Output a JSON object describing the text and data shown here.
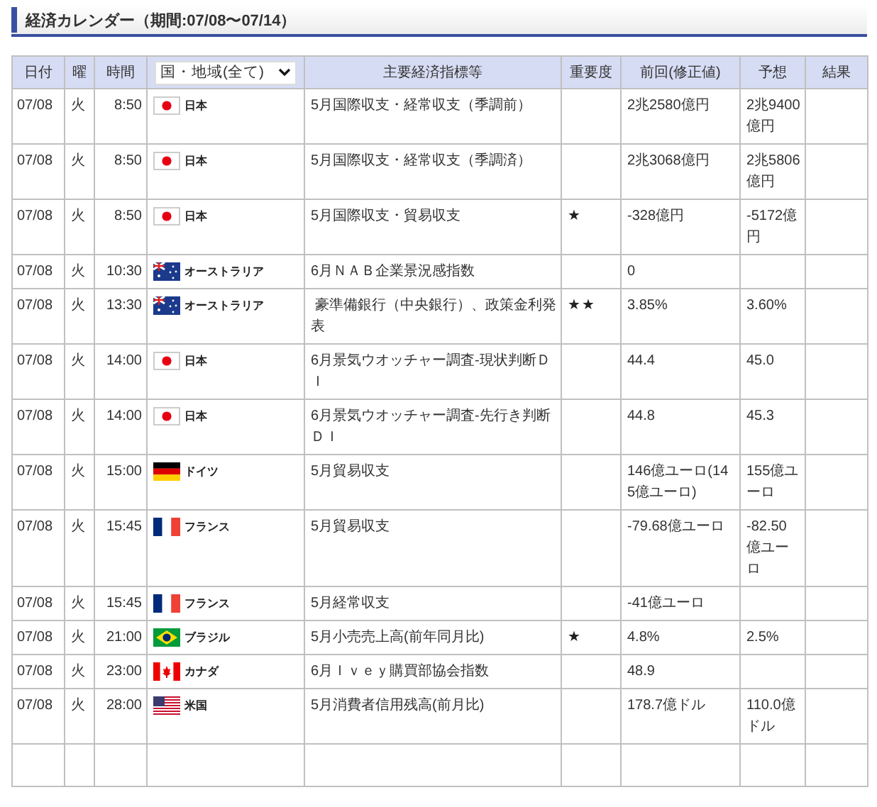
{
  "title": "経済カレンダー（期間:07/08〜07/14）",
  "table": {
    "columns": [
      "日付",
      "曜",
      "時間",
      "主要経済指標等",
      "重要度",
      "前回(修正値)",
      "予想",
      "結果"
    ],
    "country_filter": {
      "value": "国・地域(全て)"
    },
    "rows": [
      {
        "date": "07/08",
        "weekday": "火",
        "time": "8:50",
        "kind": "jp",
        "country": "日本",
        "indicator": "5月国際収支・経常収支（季調前）",
        "previous": "2兆2580億円",
        "forecast": "2兆9400億円"
      },
      {
        "date": "07/08",
        "weekday": "火",
        "time": "8:50",
        "kind": "jp",
        "country": "日本",
        "indicator": "5月国際収支・経常収支（季調済）",
        "previous": "2兆3068億円",
        "forecast": "2兆5806億円"
      },
      {
        "date": "07/08",
        "weekday": "火",
        "time": "8:50",
        "kind": "jp",
        "country": "日本",
        "indicator": "5月国際収支・貿易収支",
        "importance": "★",
        "previous": "-328億円",
        "forecast": "-5172億円"
      },
      {
        "date": "07/08",
        "weekday": "火",
        "time": "10:30",
        "kind": "au",
        "country": "オーストラリア",
        "indicator": "6月ＮＡＢ企業景況感指数",
        "previous": "0"
      },
      {
        "date": "07/08",
        "weekday": "火",
        "time": "13:30",
        "kind": "au",
        "country": "オーストラリア",
        "indicator": " 豪準備銀行（中央銀行）、政策金利発表",
        "importance": "★★",
        "previous": "3.85%",
        "forecast": "3.60%"
      },
      {
        "date": "07/08",
        "weekday": "火",
        "time": "14:00",
        "kind": "jp",
        "country": "日本",
        "indicator": "6月景気ウオッチャー調査-現状判断ＤＩ",
        "previous": "44.4",
        "forecast": "45.0"
      },
      {
        "date": "07/08",
        "weekday": "火",
        "time": "14:00",
        "kind": "jp",
        "country": "日本",
        "indicator": "6月景気ウオッチャー調査-先行き判断ＤＩ",
        "previous": "44.8",
        "forecast": "45.3"
      },
      {
        "date": "07/08",
        "weekday": "火",
        "time": "15:00",
        "kind": "de",
        "country": "ドイツ",
        "indicator": "5月貿易収支",
        "previous": "146億ユーロ(145億ユーロ)",
        "forecast": "155億ユーロ"
      },
      {
        "date": "07/08",
        "weekday": "火",
        "time": "15:45",
        "kind": "fr",
        "country": "フランス",
        "indicator": "5月貿易収支",
        "previous": "-79.68億ユーロ",
        "forecast": "-82.50億ユーロ"
      },
      {
        "date": "07/08",
        "weekday": "火",
        "time": "15:45",
        "kind": "fr",
        "country": "フランス",
        "indicator": "5月経常収支",
        "previous": "-41億ユーロ"
      },
      {
        "date": "07/08",
        "weekday": "火",
        "time": "21:00",
        "kind": "br",
        "country": "ブラジル",
        "indicator": "5月小売売上高(前年同月比)",
        "importance": "★",
        "previous": "4.8%",
        "forecast": "2.5%"
      },
      {
        "date": "07/08",
        "weekday": "火",
        "time": "23:00",
        "kind": "ca",
        "country": "カナダ",
        "indicator": "6月Ｉｖｅｙ購買部協会指数",
        "previous": "48.9"
      },
      {
        "date": "07/08",
        "weekday": "火",
        "time": "28:00",
        "kind": "us",
        "country": "米国",
        "indicator": "5月消費者信用残高(前月比)",
        "previous": "178.7億ドル",
        "forecast": "110.0億ドル"
      }
    ]
  }
}
